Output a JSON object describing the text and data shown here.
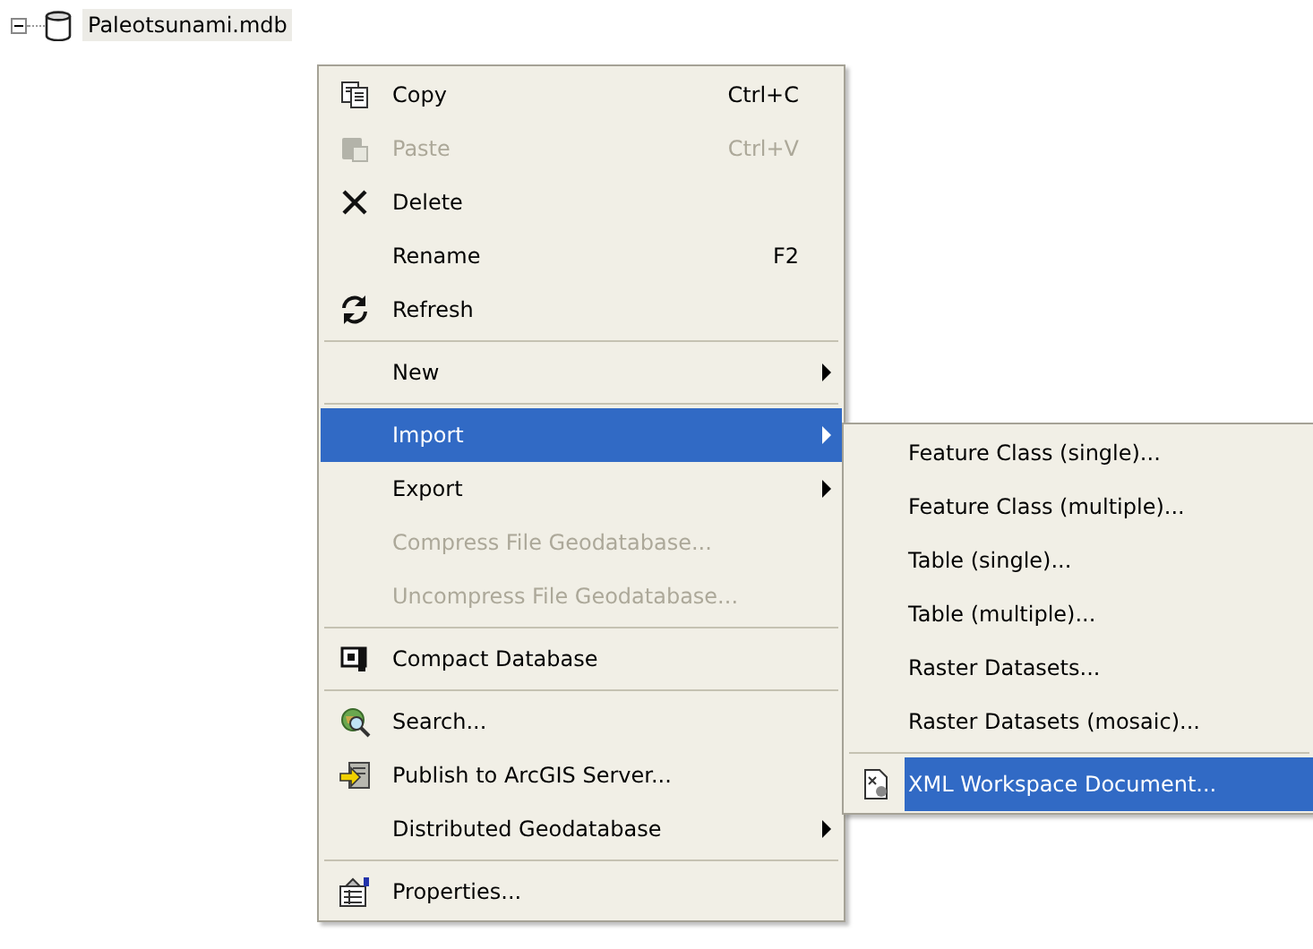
{
  "tree": {
    "label": "Paleotsunami.mdb",
    "expanded": true,
    "selected": true
  },
  "context_menu": {
    "items": [
      {
        "kind": "copy",
        "label": "Copy",
        "shortcut": "Ctrl+C",
        "disabled": false,
        "selected": false,
        "submenu": false
      },
      {
        "kind": "paste",
        "label": "Paste",
        "shortcut": "Ctrl+V",
        "disabled": true,
        "selected": false,
        "submenu": false
      },
      {
        "kind": "delete",
        "label": "Delete",
        "disabled": false,
        "selected": false,
        "submenu": false
      },
      {
        "kind": "plain",
        "label": "Rename",
        "shortcut": "F2",
        "disabled": false,
        "selected": false,
        "submenu": false
      },
      {
        "kind": "refresh",
        "label": "Refresh",
        "disabled": false,
        "selected": false,
        "submenu": false
      },
      {
        "kind": "separator"
      },
      {
        "kind": "plain",
        "label": "New",
        "disabled": false,
        "selected": false,
        "submenu": true
      },
      {
        "kind": "separator"
      },
      {
        "kind": "plain",
        "label": "Import",
        "disabled": false,
        "selected": true,
        "submenu": true
      },
      {
        "kind": "plain",
        "label": "Export",
        "disabled": false,
        "selected": false,
        "submenu": true
      },
      {
        "kind": "plain",
        "label": "Compress File Geodatabase...",
        "disabled": true,
        "selected": false,
        "submenu": false
      },
      {
        "kind": "plain",
        "label": "Uncompress File Geodatabase...",
        "disabled": true,
        "selected": false,
        "submenu": false
      },
      {
        "kind": "separator"
      },
      {
        "kind": "compact",
        "label": "Compact Database",
        "disabled": false,
        "selected": false,
        "submenu": false
      },
      {
        "kind": "separator"
      },
      {
        "kind": "search",
        "label": "Search...",
        "disabled": false,
        "selected": false,
        "submenu": false
      },
      {
        "kind": "publish",
        "label": "Publish to ArcGIS Server...",
        "disabled": false,
        "selected": false,
        "submenu": false
      },
      {
        "kind": "plain",
        "label": "Distributed Geodatabase",
        "disabled": false,
        "selected": false,
        "submenu": true
      },
      {
        "kind": "separator"
      },
      {
        "kind": "properties",
        "label": "Properties...",
        "disabled": false,
        "selected": false,
        "submenu": false
      }
    ]
  },
  "import_submenu": {
    "items": [
      {
        "kind": "plain",
        "label": "Feature Class (single)...",
        "disabled": false,
        "selected": false,
        "submenu": false
      },
      {
        "kind": "plain",
        "label": "Feature Class (multiple)...",
        "disabled": false,
        "selected": false,
        "submenu": false
      },
      {
        "kind": "plain",
        "label": "Table (single)...",
        "disabled": false,
        "selected": false,
        "submenu": false
      },
      {
        "kind": "plain",
        "label": "Table (multiple)...",
        "disabled": false,
        "selected": false,
        "submenu": false
      },
      {
        "kind": "plain",
        "label": "Raster Datasets...",
        "disabled": false,
        "selected": false,
        "submenu": false
      },
      {
        "kind": "plain",
        "label": "Raster Datasets (mosaic)...",
        "disabled": false,
        "selected": false,
        "submenu": false
      },
      {
        "kind": "separator"
      },
      {
        "kind": "xml",
        "label": "XML Workspace Document...",
        "disabled": false,
        "selected": true,
        "submenu": false
      }
    ]
  }
}
